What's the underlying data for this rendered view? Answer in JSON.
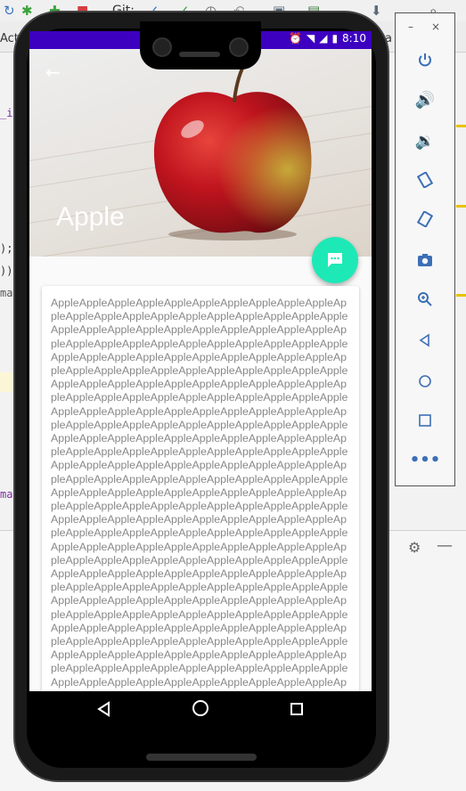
{
  "ide": {
    "git_label": "Git:",
    "tab_fragment_left": "Acti",
    "tab_fragment_right": "a",
    "code_fragments": [
      "_i",
      ");",
      "))",
      "ma",
      "ma"
    ]
  },
  "status_bar": {
    "time": "8:10"
  },
  "app": {
    "title": "Apple",
    "body_text": "AppleAppleAppleAppleAppleAppleAppleAppleAppleAppleAppleAppleAppleAppleAppleAppleAppleAppleAppleAppleAppleAppleAppleAppleAppleAppleAppleAppleAppleAppleAppleAppleAppleAppleAppleAppleAppleAppleAppleAppleAppleAppleAppleAppleAppleAppleAppleAppleAppleAppleAppleAppleAppleAppleAppleAppleAppleAppleAppleAppleAppleAppleAppleAppleAppleAppleAppleAppleAppleAppleAppleAppleAppleAppleAppleAppleAppleAppleAppleAppleAppleAppleAppleAppleAppleAppleAppleAppleAppleAppleAppleAppleAppleAppleAppleAppleAppleAppleAppleAppleAppleAppleAppleAppleAppleAppleAppleAppleAppleAppleAppleAppleAppleAppleAppleAppleAppleAppleAppleAppleAppleAppleAppleAppleAppleAppleAppleAppleAppleAppleAppleAppleAppleAppleAppleAppleAppleAppleAppleAppleAppleAppleAppleAppleAppleAppleAppleAppleAppleAppleAppleAppleAppleAppleAppleAppleAppleAppleAppleAppleAppleAppleAppleAppleAppleAppleAppleAppleAppleAppleAppleAppleAppleAppleAppleAppleAppleAppleAppleAppleAppleAppleAppleAppleAppleAppleAppleAppleAppleAppleAppleAppleAppleAppleAppleAppleAppleAppleAppleAppleAppleAppleAppleAppleAppleAppleAppleAppleAppleAppleAppleAppleAppleAppleAppleAppleAppleAppleAppleAppleAppleAppleAppleAppleAppleAppleAppleAppleAppleAppleAppleAppleAppleAppleAppleAppleAppleAppleAppleAppleAppleAppleAppleAppleAppleAppleAppleAppleAppleAppleAppleAppleAppleAppleAppleAppleAppleAppleAppleAppleAppleAppleAppleAppleAppleAppleAppleAppleAppleAppleAppleAppleAppleAppleAppleAppleAppleAppleAppleAppleAppleAppleAppleAppleAppleAppleAppleAppleAppleAppleAppleAppleAppleAppleAppleAppleAppleAppleAppleAppleAppleAppleAppleAppleAppleAppleAppleAppleAppleAppleAppleAppleAppleAppleAppleAppleAppleAppleAppleAppleAppleAppleAppleAppleAppleAppleAppleAppleAppleAppleAppleAppleAppleAppleAppleAppleAppleAppleAppleAppleAppleAppleAppleAppleAppleAppleAppleAppleAppleAppleAppleAppleAppleAppleAppleAppleAppleAppleAppleAppleAppleAppleAppleAppleAppleAppleAppleAppleAppleAppleAppleAppleAppleAppleAppleAppleAppleAppleAppleAppleAppleAppleAppleAppleAppleAppleAppleAppleAppleAppleAppleAppleAppleAppleAppleAppleAppleAppleAppleAppleAppleAppleAppleAppleAppleApple"
  },
  "colors": {
    "status_bar": "#3d00c0",
    "fab": "#1de9b6",
    "emulator_icons": "#3d6fb6"
  },
  "icons": {
    "back": "arrow-left-icon",
    "fab": "chat-icon",
    "nav": [
      "triangle-back-icon",
      "circle-home-icon",
      "square-recents-icon"
    ],
    "emulator": [
      "power-icon",
      "volume-up-icon",
      "volume-down-icon",
      "rotate-left-icon",
      "rotate-right-icon",
      "camera-icon",
      "zoom-icon",
      "back-icon",
      "home-icon",
      "overview-icon",
      "more-icon"
    ]
  }
}
